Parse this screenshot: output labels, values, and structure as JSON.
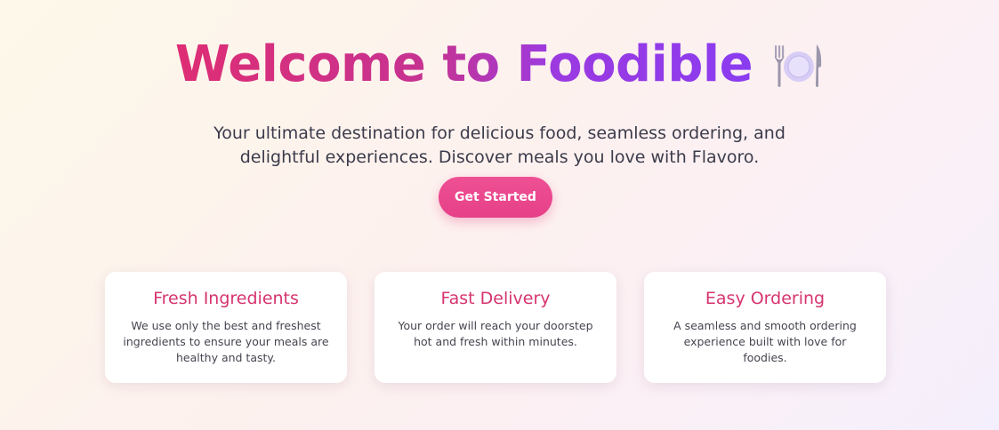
{
  "hero": {
    "title": "Welcome to Foodible",
    "title_icon": "plate-with-cutlery-icon",
    "subtitle_line1": "Your ultimate destination for delicious food, seamless ordering, and",
    "subtitle_line2": "delightful experiences. Discover meals you love with Flavoro.",
    "cta_label": "Get Started"
  },
  "features": [
    {
      "title": "Fresh Ingredients",
      "description": "We use only the best and freshest ingredients to ensure your meals are healthy and tasty."
    },
    {
      "title": "Fast Delivery",
      "description": "Your order will reach your doorstep hot and fresh within minutes."
    },
    {
      "title": "Easy Ordering",
      "description": "A seamless and smooth ordering experience built with love for foodies."
    }
  ],
  "colors": {
    "title_gradient_start": "#de2d74",
    "title_gradient_end": "#8a3cf0",
    "accent": "#e64088",
    "card_title": "#d6346f"
  }
}
